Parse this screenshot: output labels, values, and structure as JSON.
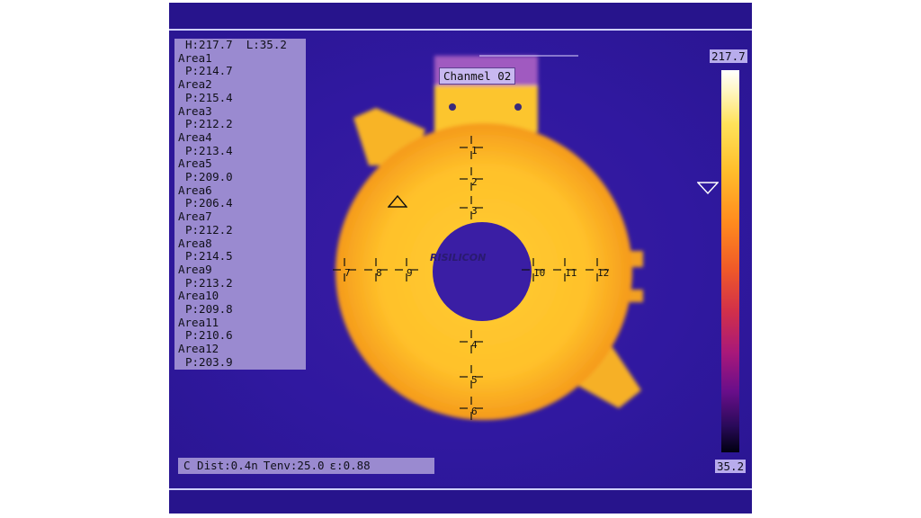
{
  "readout": {
    "high_low": "H:217.7  L:35.2",
    "areas": [
      {
        "name": "Area1",
        "value": "P:214.7"
      },
      {
        "name": "Area2",
        "value": "P:215.4"
      },
      {
        "name": "Area3",
        "value": "P:212.2"
      },
      {
        "name": "Area4",
        "value": "P:213.4"
      },
      {
        "name": "Area5",
        "value": "P:209.0"
      },
      {
        "name": "Area6",
        "value": "P:206.4"
      },
      {
        "name": "Area7",
        "value": "P:212.2"
      },
      {
        "name": "Area8",
        "value": "P:214.5"
      },
      {
        "name": "Area9",
        "value": "P:213.2"
      },
      {
        "name": "Area10",
        "value": "P:209.8"
      },
      {
        "name": "Area11",
        "value": "P:210.6"
      },
      {
        "name": "Area12",
        "value": "P:203.9"
      }
    ]
  },
  "scale": {
    "max": "217.7",
    "min": "35.2"
  },
  "channel_label": "Chanmel 02",
  "brand": "RISILICON",
  "status": {
    "distance": "C Dist:0.4n",
    "temp_env": "Tenv:25.0",
    "emissivity": "ε:0.88"
  },
  "crosshairs": [
    "1",
    "2",
    "3",
    "4",
    "5",
    "6",
    "7",
    "8",
    "9",
    "10",
    "11",
    "12"
  ],
  "icons": {
    "level_marker": "triangle-down-icon",
    "area_marker": "triangle-up-icon"
  }
}
